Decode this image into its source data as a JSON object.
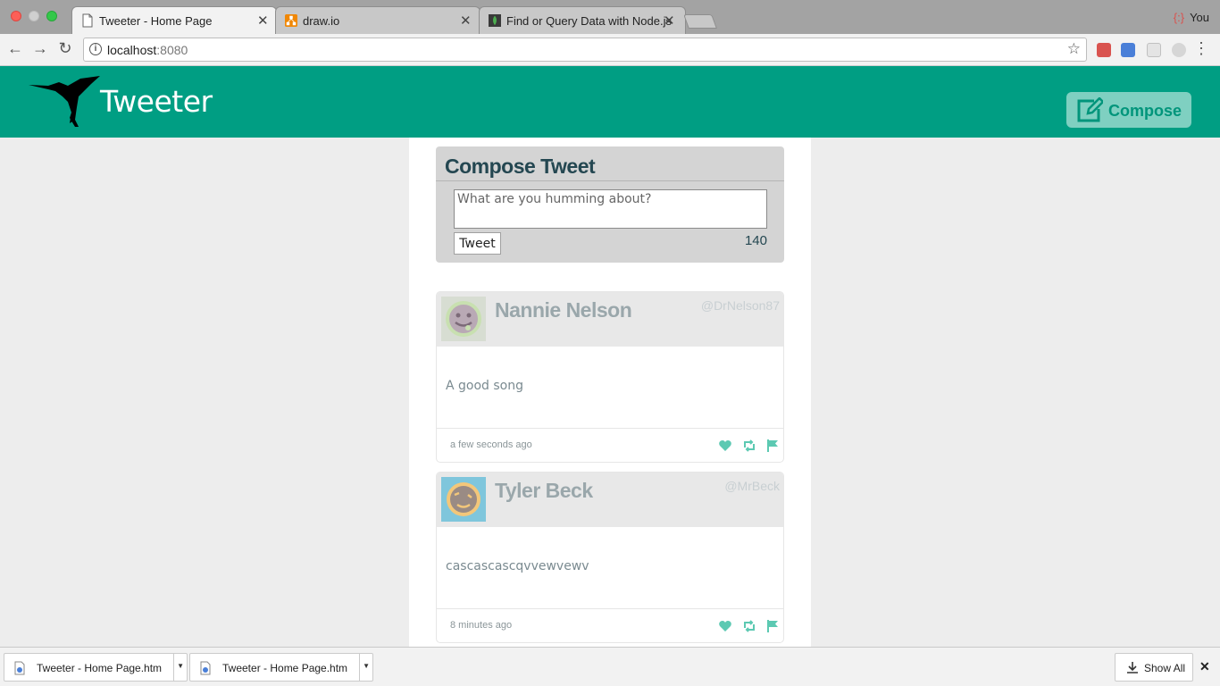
{
  "browser": {
    "tabs": [
      {
        "title": "Tweeter - Home Page",
        "active": true
      },
      {
        "title": "draw.io",
        "active": false
      },
      {
        "title": "Find or Query Data with Node.js",
        "active": false
      }
    ],
    "profile_name": "You",
    "url_host": "localhost",
    "url_port": ":8080"
  },
  "navbar": {
    "brand": "Tweeter",
    "compose_label": "Compose"
  },
  "new_tweet": {
    "heading": "Compose Tweet",
    "placeholder": "What are you humming about?",
    "button_label": "Tweet",
    "counter": "140"
  },
  "tweets": [
    {
      "name": "Nannie Nelson",
      "handle": "@DrNelson87",
      "content": "A good song",
      "time": "a few seconds ago",
      "avatar_color": "#c8d9b8"
    },
    {
      "name": "Tyler Beck",
      "handle": "@MrBeck",
      "content": "cascascascqvvewvewv",
      "time": "8 minutes ago",
      "avatar_color": "#7fc6dc"
    }
  ],
  "downloads": {
    "items": [
      "Tweeter - Home Page.htm",
      "Tweeter - Home Page.htm"
    ],
    "show_all_label": "Show All"
  },
  "colors": {
    "navbar": "#009e83",
    "accent": "#7fd0c1",
    "icon_teal": "#5cc9b2"
  }
}
